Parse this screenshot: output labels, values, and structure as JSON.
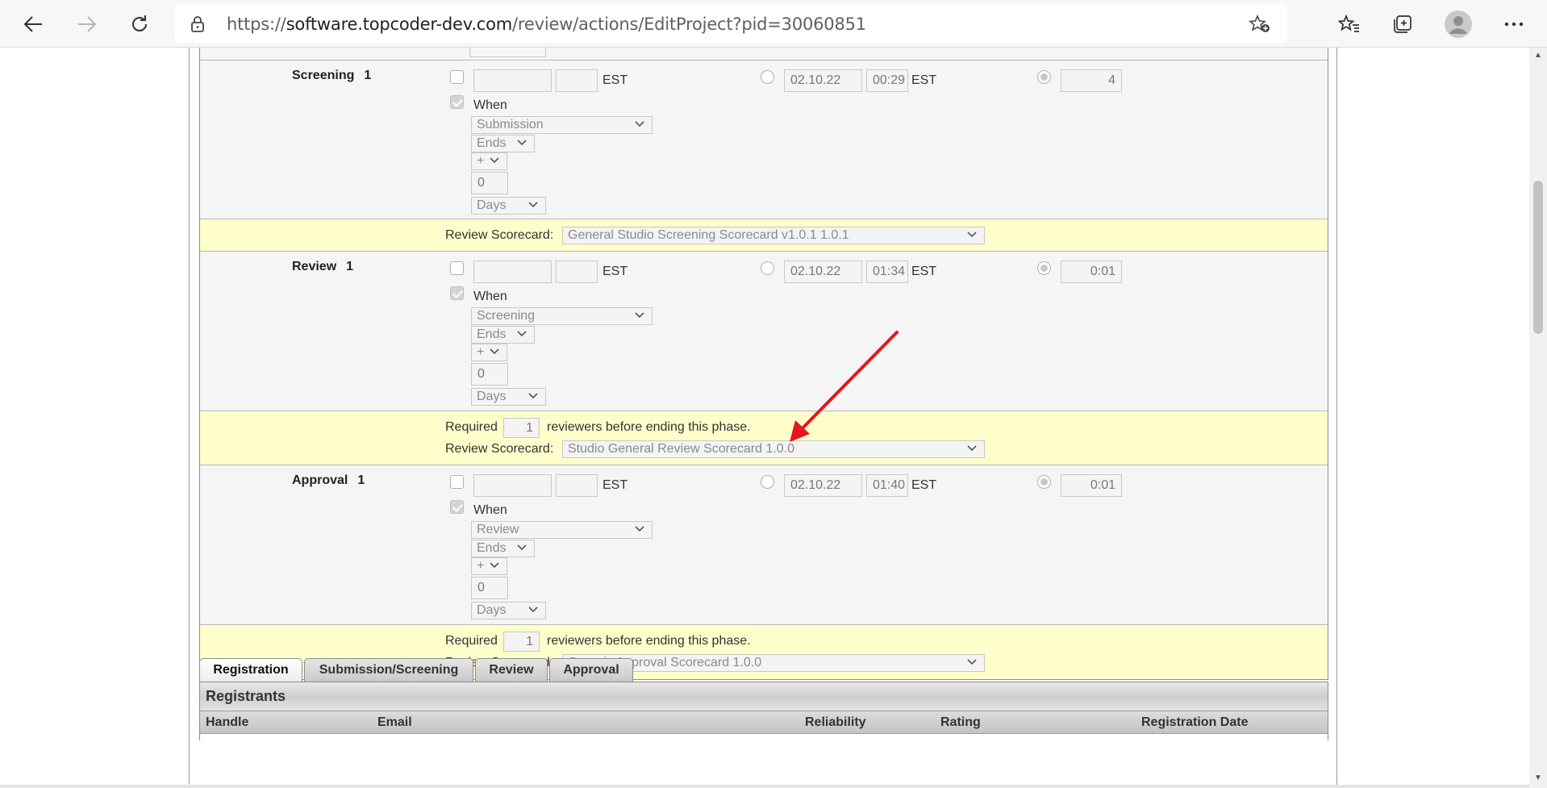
{
  "browser": {
    "url_prefix": "https://",
    "url_host": "software.topcoder-dev.com",
    "url_path": "/review/actions/EditProject?pid=30060851"
  },
  "phases": [
    {
      "name": "Screening",
      "number": "1",
      "tz1": "EST",
      "when": "When",
      "when_phase": "Submission",
      "when_event": "Ends",
      "sign": "+",
      "offset": "0",
      "unit": "Days",
      "date": "02.10.22",
      "time": "00:29",
      "tz2": "EST",
      "duration": "4"
    },
    {
      "name": "Review",
      "number": "1",
      "tz1": "EST",
      "when": "When",
      "when_phase": "Screening",
      "when_event": "Ends",
      "sign": "+",
      "offset": "0",
      "unit": "Days",
      "date": "02.10.22",
      "time": "01:34",
      "tz2": "EST",
      "duration": "0:01"
    },
    {
      "name": "Approval",
      "number": "1",
      "tz1": "EST",
      "when": "When",
      "when_phase": "Review",
      "when_event": "Ends",
      "sign": "+",
      "offset": "0",
      "unit": "Days",
      "date": "02.10.22",
      "time": "01:40",
      "tz2": "EST",
      "duration": "0:01"
    }
  ],
  "screening_scorecard": {
    "label": "Review Scorecard:",
    "value": "General Studio Screening Scorecard v1.0.1 1.0.1"
  },
  "review_settings": {
    "required_label": "Required",
    "required_count": "1",
    "required_suffix": "reviewers before ending this phase.",
    "label": "Review Scorecard:",
    "value": "Studio General Review Scorecard 1.0.0"
  },
  "approval_settings": {
    "required_label": "Required",
    "required_count": "1",
    "required_suffix": "reviewers before ending this phase.",
    "label": "Review Scorecard:",
    "value": "Generic Approval Scorecard 1.0.0"
  },
  "tabs": [
    {
      "label": "Registration",
      "active": true
    },
    {
      "label": "Submission/Screening",
      "active": false
    },
    {
      "label": "Review",
      "active": false
    },
    {
      "label": "Approval",
      "active": false
    }
  ],
  "registrants": {
    "title": "Registrants",
    "columns": [
      "Handle",
      "Email",
      "Reliability",
      "Rating",
      "Registration Date"
    ]
  },
  "colors": {
    "highlight_row": "#ffffcc",
    "annotation_arrow": "#e8161b",
    "panel_bg": "#f5f5f5"
  }
}
